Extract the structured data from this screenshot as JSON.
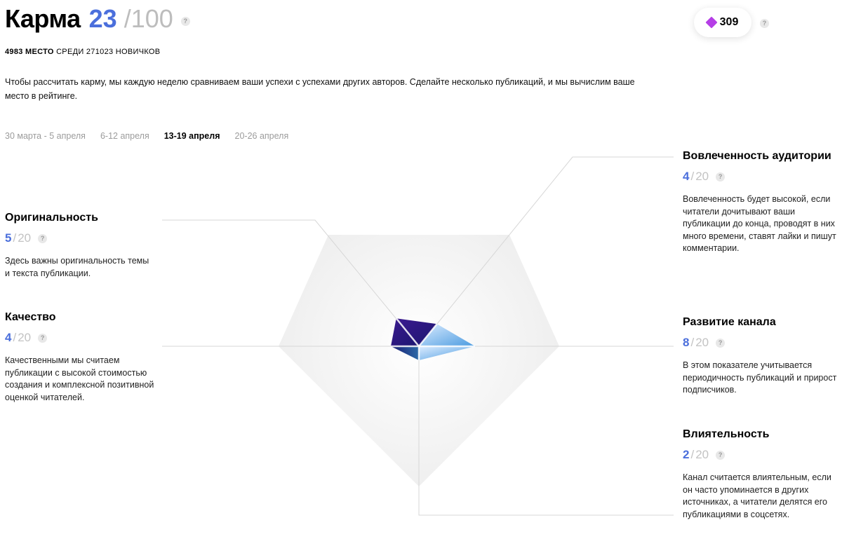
{
  "header": {
    "title": "Карма",
    "score": "23",
    "max": "/100",
    "help": "?"
  },
  "rank": {
    "place": "4983 МЕСТО",
    "text": "СРЕДИ 271023 НОВИЧКОВ"
  },
  "intro": "Чтобы рассчитать карму, мы каждую неделю сравниваем ваши успехи с успехами других авторов. Сделайте несколько публикаций, и мы вычислим ваше место в рейтинге.",
  "weeks": [
    {
      "label": "30 марта - 5 апреля",
      "active": false
    },
    {
      "label": "6-12 апреля",
      "active": false
    },
    {
      "label": "13-19 апреля",
      "active": true
    },
    {
      "label": "20-26 апреля",
      "active": false
    }
  ],
  "gems": {
    "count": "309",
    "help": "?",
    "color": "#b53ee6"
  },
  "accent_color": "#4b6fdc",
  "metrics": [
    {
      "key": "originality",
      "title": "Оригинальность",
      "value": "5",
      "max": "20",
      "sep": "/",
      "help": "?",
      "desc": "Здесь важны оригинальность темы и текста публикации."
    },
    {
      "key": "quality",
      "title": "Качество",
      "value": "4",
      "max": "20",
      "sep": "/",
      "help": "?",
      "desc": "Качественными мы считаем публикации с высокой стоимостью создания и комплексной позитивной оценкой читателей."
    },
    {
      "key": "engagement",
      "title": "Вовлеченность аудитории",
      "value": "4",
      "max": "20",
      "sep": "/",
      "help": "?",
      "desc": "Вовлеченность будет высокой, если читатели дочитывают ваши публикации до конца, проводят в них много времени, ставят лайки и пишут комментарии."
    },
    {
      "key": "growth",
      "title": "Развитие канала",
      "value": "8",
      "max": "20",
      "sep": "/",
      "help": "?",
      "desc": "В этом показателе учитывается периодичность публикаций и прирост подписчиков."
    },
    {
      "key": "influence",
      "title": "Влиятельность",
      "value": "2",
      "max": "20",
      "sep": "/",
      "help": "?",
      "desc": "Канал считается влиятельным, если он часто упоминается в других источниках, а читатели делятся его публикациями в соцсетях."
    }
  ],
  "chart_data": {
    "type": "radar",
    "max": 20,
    "axes": [
      "Оригинальность",
      "Вовлеченность аудитории",
      "Развитие канала",
      "Влиятельность",
      "Качество"
    ],
    "values": [
      5,
      4,
      8,
      2,
      4
    ]
  }
}
